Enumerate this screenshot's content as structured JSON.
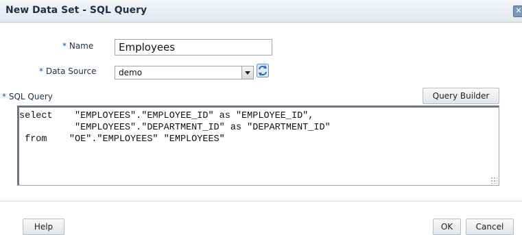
{
  "dialog": {
    "title": "New Data Set - SQL Query",
    "close_icon": "close-icon"
  },
  "form": {
    "name_required": "*",
    "name_label": "Name",
    "name_value": "Employees",
    "datasource_required": "*",
    "datasource_label": "Data Source",
    "datasource_value": "demo",
    "refresh_icon": "refresh-icon",
    "sql_required": "*",
    "sql_label": "SQL Query",
    "query_builder_label": "Query Builder",
    "sql_text": "select    \"EMPLOYEES\".\"EMPLOYEE_ID\" as \"EMPLOYEE_ID\",\n          \"EMPLOYEES\".\"DEPARTMENT_ID\" as \"DEPARTMENT_ID\"\n from    \"OE\".\"EMPLOYEES\" \"EMPLOYEES\""
  },
  "footer": {
    "help_label": "Help",
    "ok_label": "OK",
    "cancel_label": "Cancel"
  },
  "colors": {
    "required_marker": "#0057b7",
    "title_text": "#1f3045",
    "titlebar_bg": "#e2e7ee"
  }
}
